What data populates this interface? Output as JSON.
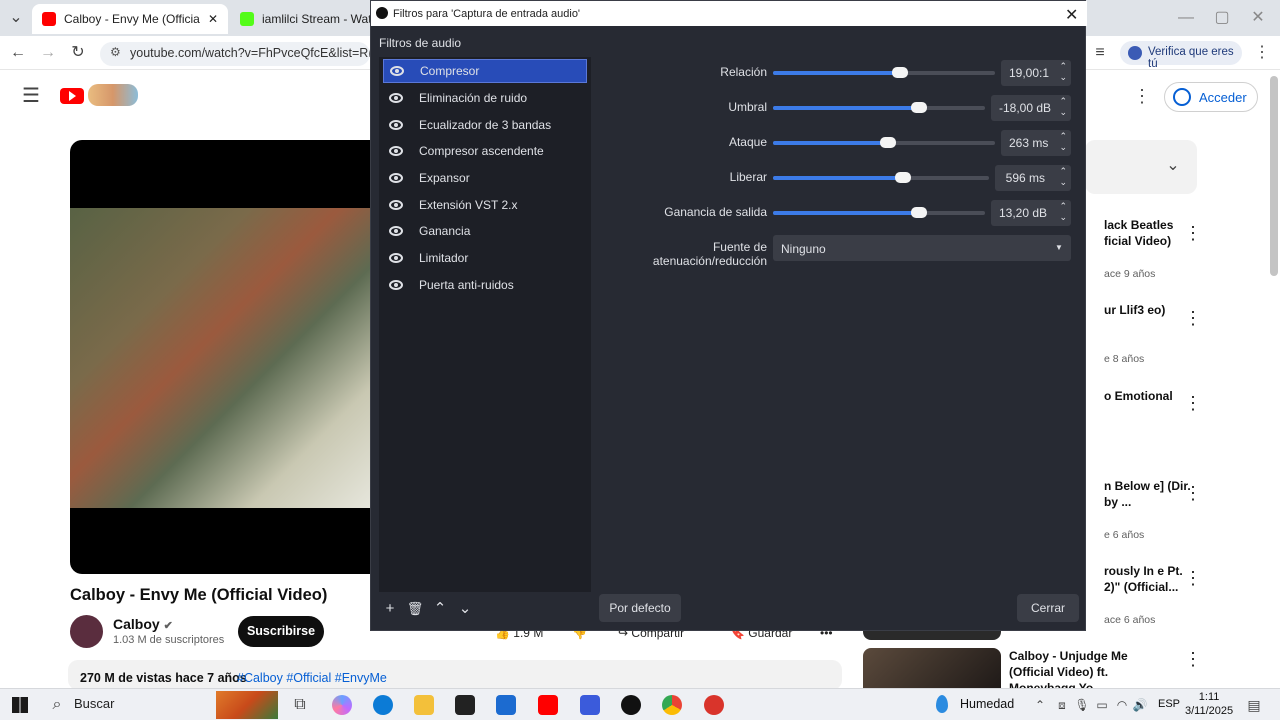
{
  "browser": {
    "tabs": [
      {
        "label": "Calboy - Envy Me (Official Vide"
      },
      {
        "label": "iamlilci Stream - Watch L"
      }
    ],
    "url": "youtube.com/watch?v=FhPvceQfcE&list=RDF",
    "verify_label": "Verifica que eres tú"
  },
  "youtube": {
    "signin_label": "Acceder",
    "video_title": "Calboy - Envy Me (Official Video)",
    "channel_name": "Calboy",
    "subscribers": "1.03 M de suscriptores",
    "subscribe_label": "Suscribirse",
    "likes": "1.9 M",
    "share_label": "Compartir",
    "save_label": "Guardar",
    "views_date": "270 M de vistas  hace 7 años",
    "tags": "#Calboy #Official #EnvyMe",
    "sidebar": [
      {
        "title": "lack Beatles ficial Video)",
        "meta": "ace 9 años"
      },
      {
        "title": "ur Llif3 eo)",
        "meta": "e 8 años"
      },
      {
        "title": "o Emotional",
        "meta": ""
      },
      {
        "title": "n Below e] (Dir. by ...",
        "meta": "e 6 años"
      },
      {
        "title": "rously In e Pt. 2)\" (Official...",
        "meta": "ace 6 años"
      },
      {
        "title": "Calboy - Unjudge Me (Official Video) ft. Moneybagg Yo",
        "meta": ""
      }
    ]
  },
  "obs": {
    "window_title": "Filtros para 'Captura de entrada audio'",
    "filters_label": "Filtros de audio",
    "filters": [
      {
        "label": "Compresor",
        "selected": true
      },
      {
        "label": "Eliminación de ruido",
        "selected": false
      },
      {
        "label": "Ecualizador de 3 bandas",
        "selected": false
      },
      {
        "label": "Compresor ascendente",
        "selected": false
      },
      {
        "label": "Expansor",
        "selected": false
      },
      {
        "label": "Extensión VST 2.x",
        "selected": false
      },
      {
        "label": "Ganancia",
        "selected": false
      },
      {
        "label": "Limitador",
        "selected": false
      },
      {
        "label": "Puerta anti-ruidos",
        "selected": false
      }
    ],
    "params": [
      {
        "label": "Relación",
        "value": "19,00:1",
        "level": 0.57
      },
      {
        "label": "Umbral",
        "value": "-18,00 dB",
        "level": 0.69
      },
      {
        "label": "Ataque",
        "value": "263 ms",
        "level": 0.52
      },
      {
        "label": "Liberar",
        "value": "596 ms",
        "level": 0.6
      },
      {
        "label": "Ganancia de salida",
        "value": "13,20 dB",
        "level": 0.69
      }
    ],
    "sidechain_label": "Fuente de atenuación/reducción",
    "sidechain_value": "Ninguno",
    "defaults_label": "Por defecto",
    "close_label": "Cerrar"
  },
  "taskbar": {
    "search_label": "Buscar",
    "weather": "Humedad",
    "language": "ESP",
    "time": "1:11",
    "date": "3/11/2025"
  },
  "colors": {
    "accent": "#284cb8",
    "slider": "#3c7be8",
    "youtube_red": "#ff0000"
  }
}
